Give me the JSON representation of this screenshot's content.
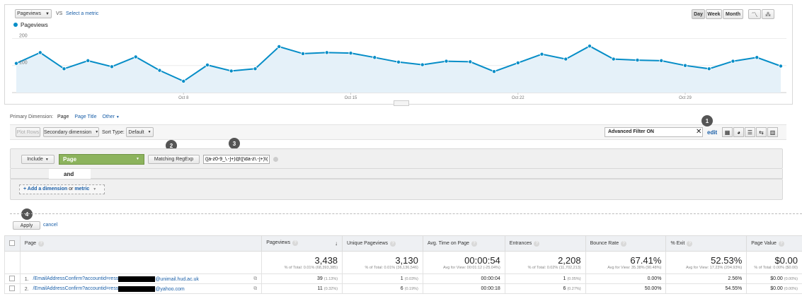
{
  "metric": {
    "selected": "Pageviews",
    "vs": "VS",
    "select_metric": "Select a metric"
  },
  "period": {
    "day": "Day",
    "week": "Week",
    "month": "Month"
  },
  "legend": {
    "series": "Pageviews"
  },
  "chart_data": {
    "type": "area",
    "series": [
      {
        "name": "Pageviews",
        "values": [
          108,
          148,
          88,
          118,
          96,
          132,
          82,
          42,
          102,
          80,
          88,
          170,
          144,
          148,
          146,
          130,
          113,
          103,
          116,
          114,
          78,
          110,
          142,
          124,
          172,
          124,
          120,
          118,
          100,
          88,
          116,
          130,
          98
        ]
      }
    ],
    "ylim": [
      0,
      230
    ],
    "y_ticks": [
      {
        "value": 200,
        "label": "200"
      },
      {
        "value": 100,
        "label": "100"
      }
    ],
    "x_ticks": [
      "Oct 8",
      "Oct 15",
      "Oct 22",
      "Oct 29"
    ],
    "color": "#058dc7"
  },
  "primary_dimension": {
    "label": "Primary Dimension:",
    "page": "Page",
    "page_title": "Page Title",
    "other": "Other"
  },
  "toolbar": {
    "plot_rows": "Plot Rows",
    "secondary_dimension": "Secondary dimension",
    "sort_type": "Sort Type:",
    "sort_default": "Default",
    "filter_value": "Advanced Filter ON",
    "edit": "edit"
  },
  "filter": {
    "include": "Include",
    "dimension": "Page",
    "match": "Matching RegExp",
    "regex": "([a-z0-9_\\.-]+)@([\\da-z\\.-]+)\\(",
    "and": "and",
    "add_prefix": "+ Add a dimension",
    "add_or": "or",
    "add_metric": "metric"
  },
  "actions": {
    "apply": "Apply",
    "cancel": "cancel"
  },
  "badges": [
    "1",
    "2",
    "3",
    "4"
  ],
  "table": {
    "headers": [
      "Page",
      "Pageviews",
      "Unique Pageviews",
      "Avg. Time on Page",
      "Entrances",
      "Bounce Rate",
      "% Exit",
      "Page Value"
    ],
    "totals": [
      {
        "value": "3,438",
        "sub": "% of Total: 0.01% (68,393,385)"
      },
      {
        "value": "3,130",
        "sub": "% of Total: 0.01% (36,136,546)"
      },
      {
        "value": "00:00:54",
        "sub": "Avg for View: 00:01:12 (-25.04%)"
      },
      {
        "value": "2,208",
        "sub": "% of Total: 0.02% (11,702,213)"
      },
      {
        "value": "67.41%",
        "sub": "Avg for View: 35.38% (90.48%)"
      },
      {
        "value": "52.53%",
        "sub": "Avg for View: 17.23% (204.93%)"
      },
      {
        "value": "$0.00",
        "sub": "% of Total: 0.00% ($0.00)"
      }
    ],
    "rows": [
      {
        "index": "1.",
        "page_start": "/EmailAddressConfirm?accountid=ress",
        "page_end": "@unimail.hud.ac.uk",
        "pageviews": "39",
        "pageviews_pct": "(1.13%)",
        "unique": "1",
        "unique_pct": "(0.03%)",
        "avg_time": "00:00:04",
        "entrances": "1",
        "entrances_pct": "(0.05%)",
        "bounce": "0.00%",
        "exit": "2.56%",
        "value": "$0.00",
        "value_pct": "(0.00%)"
      },
      {
        "index": "2.",
        "page_start": "/EmailAddressConfirm?accountid=ress",
        "page_end": "@yahoo.com",
        "pageviews": "11",
        "pageviews_pct": "(0.32%)",
        "unique": "6",
        "unique_pct": "(0.19%)",
        "avg_time": "00:00:18",
        "entrances": "6",
        "entrances_pct": "(0.27%)",
        "bounce": "50.00%",
        "exit": "54.55%",
        "value": "$0.00",
        "value_pct": "(0.00%)"
      }
    ]
  }
}
